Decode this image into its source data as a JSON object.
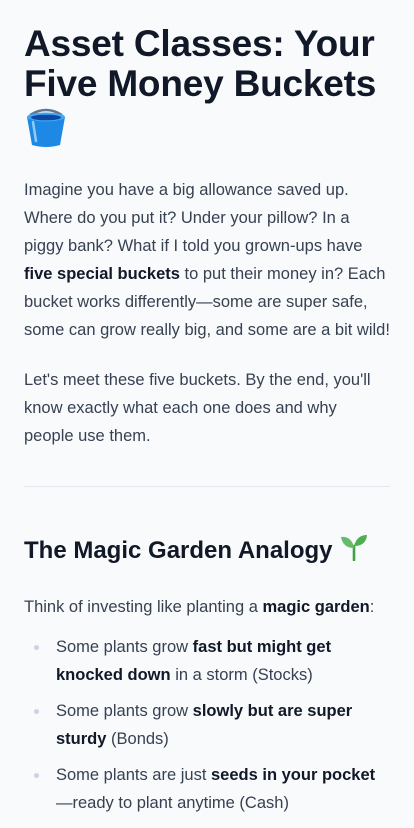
{
  "article": {
    "title": "Asset Classes: Your Five Money Buckets",
    "title_icon": "bucket-emoji",
    "intro1": {
      "before": "Imagine you have a big allowance saved up. Where do you put it? Under your pillow? In a piggy bank? What if I told you grown-ups have ",
      "bold": "five special buckets",
      "after": " to put their money in? Each bucket works differently—some are super safe, some can grow really big, and some are a bit wild!"
    },
    "intro2": "Let's meet these five buckets. By the end, you'll know exactly what each one does and why people use them.",
    "section": {
      "heading": "The Magic Garden Analogy",
      "heading_icon": "sprout-emoji",
      "intro_before": "Think of investing like planting a ",
      "intro_bold": "magic garden",
      "intro_after": ":",
      "items": [
        {
          "before": "Some plants grow ",
          "bold": "fast but might get knocked down",
          "after": " in a storm (Stocks)"
        },
        {
          "before": "Some plants grow ",
          "bold": "slowly but are super sturdy",
          "after": " (Bonds)"
        },
        {
          "before": "Some plants are just ",
          "bold": "seeds in your pocket",
          "after": "—ready to plant anytime (Cash)"
        }
      ]
    }
  },
  "colors": {
    "background": "#f8fafc",
    "heading": "#111827",
    "body_text": "#374151",
    "divider": "#e2e8f0",
    "bullet": "#cbd5e1"
  }
}
